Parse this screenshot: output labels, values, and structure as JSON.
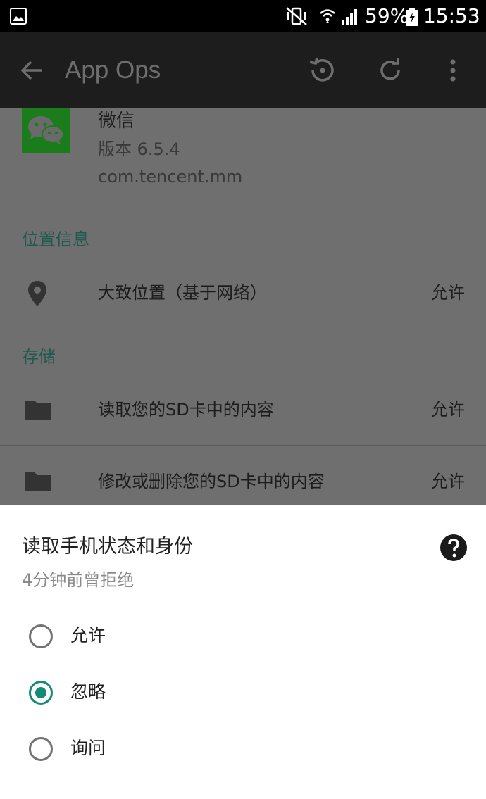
{
  "status_bar": {
    "icons": [
      "gallery-icon",
      "vibrate-icon",
      "wifi-icon",
      "signal-icon",
      "battery-charging-icon"
    ],
    "battery": "59%",
    "time": "15:53"
  },
  "app_bar": {
    "title": "App Ops",
    "icons": [
      "back-arrow-icon",
      "reset-history-icon",
      "refresh-icon",
      "more-vert-icon"
    ]
  },
  "app_info": {
    "name": "微信",
    "version": "版本 6.5.4",
    "package": "com.tencent.mm",
    "icon": "wechat-icon"
  },
  "sections": [
    {
      "header": "位置信息",
      "rows": [
        {
          "icon": "location-pin-icon",
          "label": "大致位置（基于网络）",
          "value": "允许"
        }
      ]
    },
    {
      "header": "存储",
      "rows": [
        {
          "icon": "folder-icon",
          "label": "读取您的SD卡中的内容",
          "value": "允许"
        },
        {
          "icon": "folder-icon",
          "label": "修改或删除您的SD卡中的内容",
          "value": "允许"
        }
      ]
    }
  ],
  "sheet": {
    "title": "读取手机状态和身份",
    "subtitle": "4分钟前曾拒绝",
    "help_icon": "help-icon",
    "options": [
      {
        "label": "允许",
        "selected": false
      },
      {
        "label": "忽略",
        "selected": true
      },
      {
        "label": "询问",
        "selected": false
      }
    ]
  },
  "colors": {
    "accent": "#138b79",
    "section_header": "#1f5a4f",
    "wechat_green": "#1a7c1a",
    "status_bar": "#000000",
    "app_bar": "#1d1d1d",
    "scrim_content": "#6f6f6f"
  }
}
